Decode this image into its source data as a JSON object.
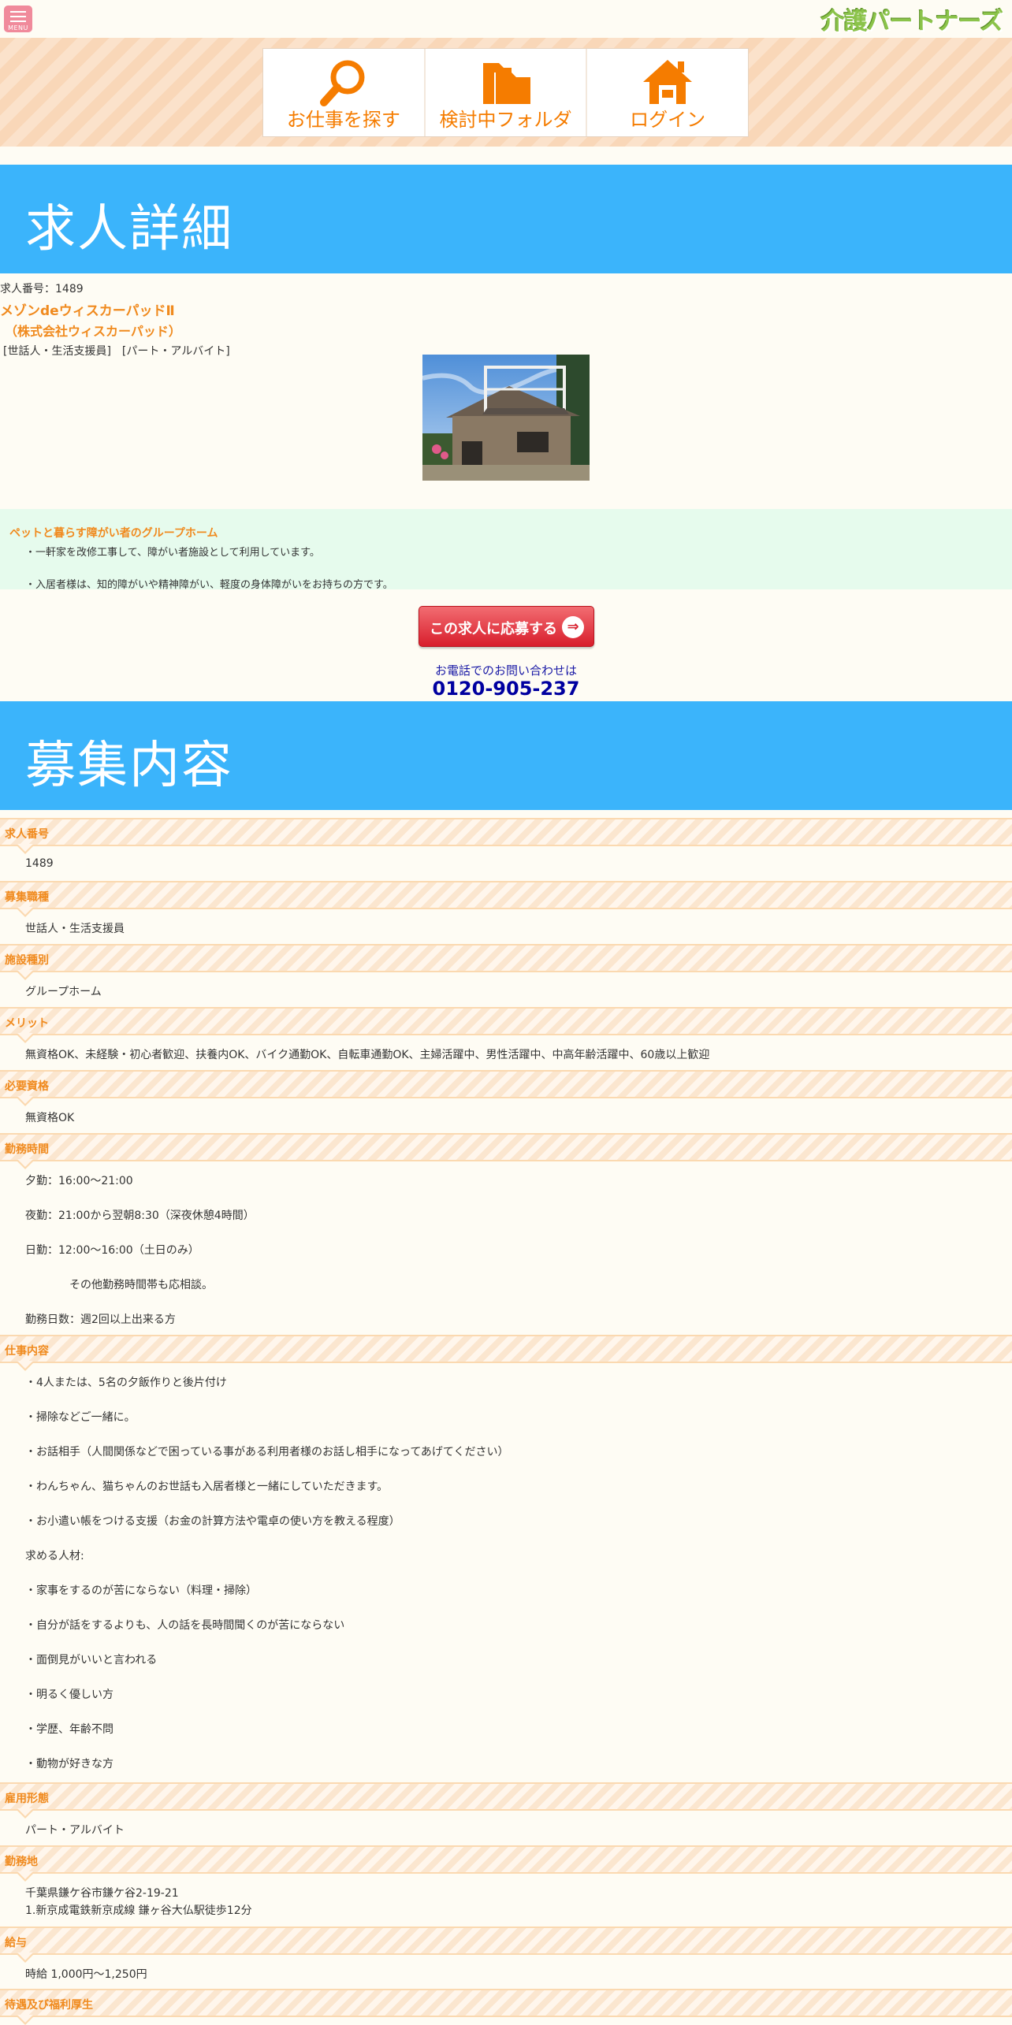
{
  "header": {
    "menu_label": "MENU",
    "logo_text": "介護パートナーズ",
    "nav": [
      {
        "label": "お仕事を探す",
        "icon": "search-icon"
      },
      {
        "label": "検討中フォルダ",
        "icon": "folder-icon"
      },
      {
        "label": "ログイン",
        "icon": "home-icon"
      }
    ]
  },
  "banners": {
    "detail": "求人詳細",
    "recruit": "募集内容"
  },
  "job": {
    "number_line": "求人番号：1489",
    "name": "メゾンdeウィスカーパッドⅡ",
    "company": "（株式会社ウィスカーパッド）",
    "tags": "[世話人・生活支援員]　[パート・アルバイト]"
  },
  "intro": {
    "heading": "ペットと暮らす障がい者のグループホーム",
    "lines": [
      "・一軒家を改修工事して、障がい者施設として利用しています。",
      "・入居者様は、知的障がいや精神障がい、軽度の身体障がいをお持ちの方です。"
    ]
  },
  "apply": {
    "label": "この求人に応募する",
    "arrow": "⇒"
  },
  "contact": {
    "caption": "お電話でのお問い合わせは",
    "phone": "0120-905-237"
  },
  "details": [
    {
      "label": "求人番号",
      "lines": [
        "1489"
      ]
    },
    {
      "label": "募集職種",
      "lines": [
        "世話人・生活支援員"
      ]
    },
    {
      "label": "施設種別",
      "lines": [
        "グループホーム"
      ]
    },
    {
      "label": "メリット",
      "lines": [
        "無資格OK、未経験・初心者歓迎、扶養内OK、バイク通勤OK、自転車通勤OK、主婦活躍中、男性活躍中、中高年齢活躍中、60歳以上歓迎"
      ]
    },
    {
      "label": "必要資格",
      "lines": [
        "無資格OK"
      ]
    },
    {
      "label": "勤務時間",
      "lines": [
        "夕勤：16:00～21:00",
        "夜勤：21:00から翌朝8:30（深夜休憩4時間）",
        "日勤：12:00～16:00（土日のみ）",
        "その他勤務時間帯も応相談。",
        "勤務日数：週2回以上出来る方"
      ]
    },
    {
      "label": "仕事内容",
      "lines": [
        "・4人または、5名の夕飯作りと後片付け",
        "・掃除などご一緒に。",
        "・お話相手（人間関係などで困っている事がある利用者様のお話し相手になってあげてください）",
        "・わんちゃん、猫ちゃんのお世話も入居者様と一緒にしていただきます。",
        "・お小遣い帳をつける支援（お金の計算方法や電卓の使い方を教える程度）",
        "求める人材:",
        "・家事をするのが苦にならない（料理・掃除）",
        "・自分が話をするよりも、人の話を長時間聞くのが苦にならない",
        "・面倒見がいいと言われる",
        "・明るく優しい方",
        "・学歴、年齢不問",
        "・動物が好きな方"
      ]
    },
    {
      "label": "雇用形態",
      "lines": [
        "パート・アルバイト"
      ]
    },
    {
      "label": "勤務地",
      "lines": [
        "千葉県鎌ケ谷市鎌ケ谷2-19-21",
        "1.新京成電鉄新京成線 鎌ヶ谷大仏駅徒歩12分"
      ]
    },
    {
      "label": "給与",
      "lines": [
        "時給 1,000円～1,250円"
      ]
    },
    {
      "label": "待遇及び福利厚生",
      "lines": []
    }
  ]
}
